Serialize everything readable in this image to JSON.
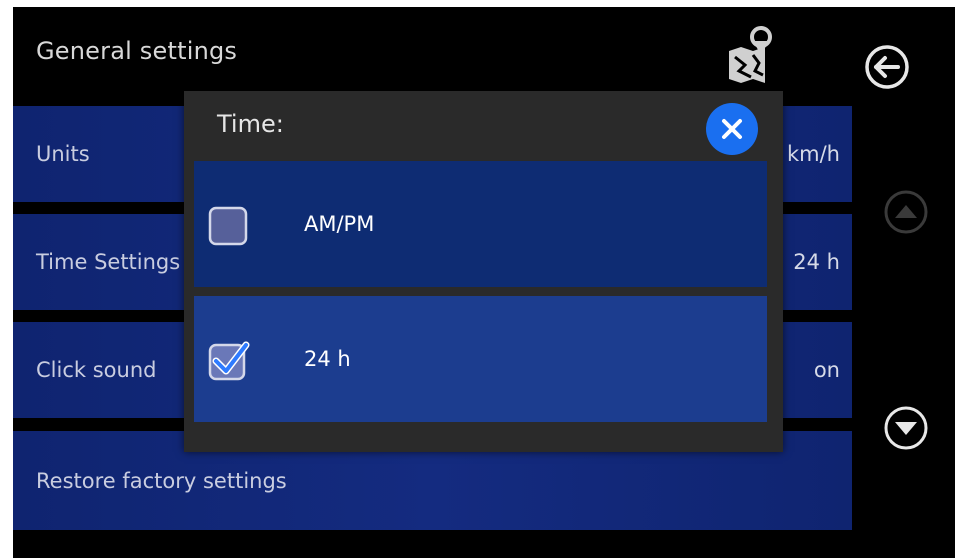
{
  "header": {
    "title": "General settings"
  },
  "settings": [
    {
      "label": "Units",
      "value": "km/h"
    },
    {
      "label": "Time Settings",
      "value": "24 h"
    },
    {
      "label": "Click sound",
      "value": "on"
    },
    {
      "label": "Restore factory settings",
      "value": ""
    }
  ],
  "dialog": {
    "title": "Time:",
    "options": [
      {
        "label": "AM/PM",
        "checked": false
      },
      {
        "label": "24 h",
        "checked": true
      }
    ]
  },
  "icons": {
    "back": "back-arrow-icon",
    "map": "map-pin-icon",
    "scroll_up": "scroll-up-icon",
    "scroll_down": "scroll-down-icon",
    "close": "close-icon",
    "checkbox_unchecked": "checkbox-unchecked-icon",
    "checkbox_checked": "checkbox-checked-icon"
  },
  "colors": {
    "background": "#000000",
    "row_blue": "#142b80",
    "selected_option": "#1c3d8f",
    "unselected_option": "#0e2c73",
    "dialog_bg": "#2a2a2a",
    "close_blue": "#1a6ff0",
    "check_blue": "#2e7bff"
  },
  "scroll": {
    "up_enabled": false,
    "down_enabled": true
  }
}
